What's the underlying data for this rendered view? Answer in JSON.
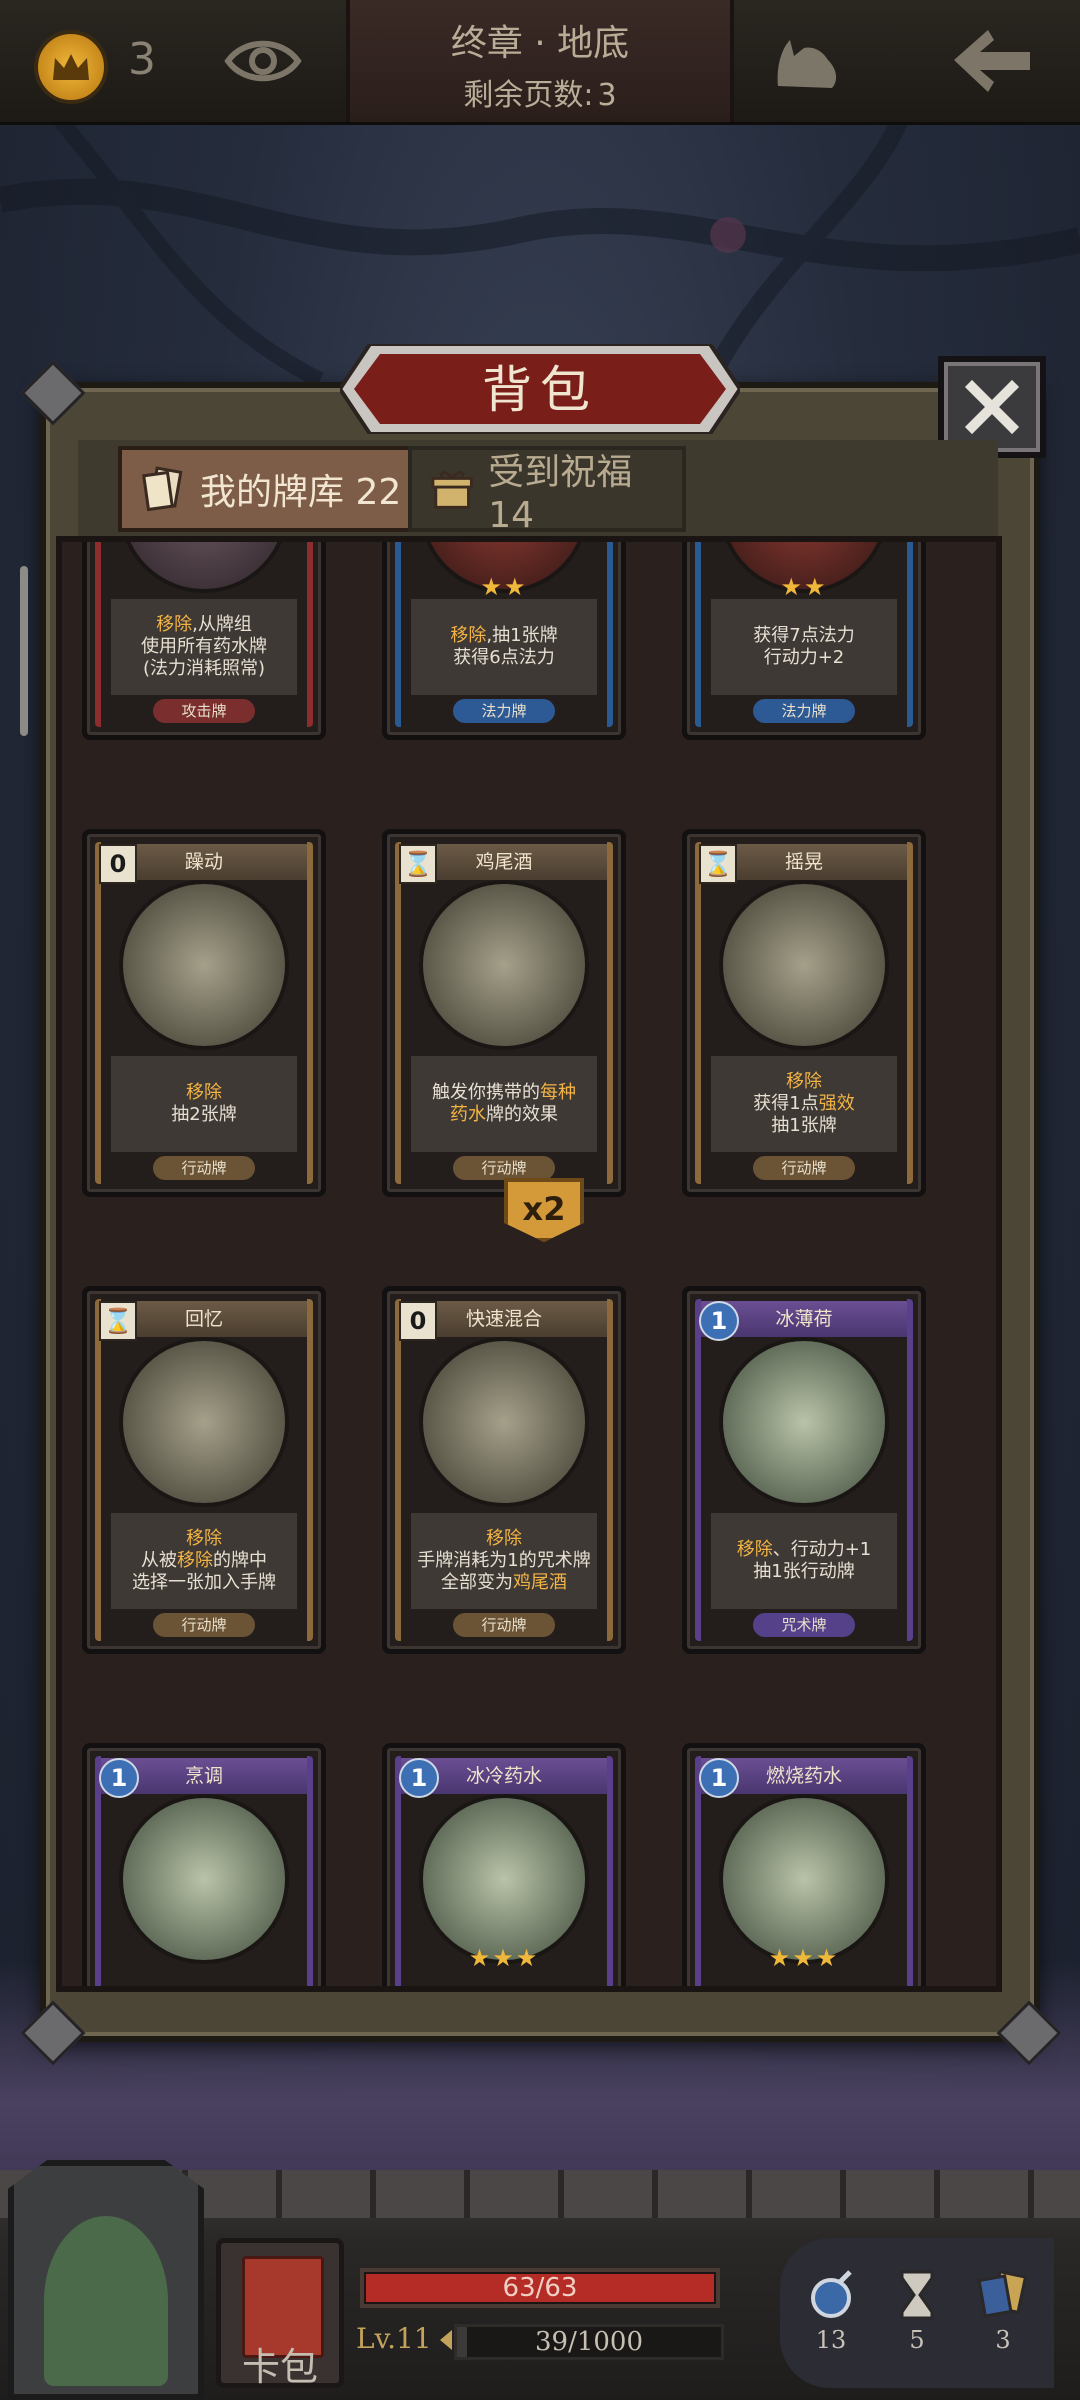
{
  "top_bar": {
    "crown_count": "3",
    "chapter": "终章 · 地底",
    "pages_label": "剩余页数:",
    "pages_value": "3"
  },
  "panel": {
    "title": "背包",
    "tabs": [
      {
        "label": "我的牌库 22",
        "active": true
      },
      {
        "label": "受到祝福 14",
        "active": false
      }
    ]
  },
  "cards": [
    {
      "name": "",
      "cost": "",
      "lines": [
        "移除,从牌组",
        "使用所有药水牌",
        "(法力消耗照常)"
      ],
      "highlight_words": [
        "移除"
      ],
      "type": "攻击牌",
      "class": "attack",
      "stars": 0
    },
    {
      "name": "",
      "cost": "",
      "lines": [
        "移除,抽1张牌",
        "获得6点法力"
      ],
      "highlight_words": [
        "移除"
      ],
      "type": "法力牌",
      "class": "magic",
      "stars": 2
    },
    {
      "name": "",
      "cost": "",
      "lines": [
        "获得7点法力",
        "行动力+2"
      ],
      "highlight_words": [],
      "type": "法力牌",
      "class": "magic",
      "stars": 2
    },
    {
      "name": "躁动",
      "cost": "0",
      "lines": [
        "移除",
        "抽2张牌"
      ],
      "highlight_words": [
        "移除"
      ],
      "type": "行动牌",
      "class": "action",
      "stars": 0
    },
    {
      "name": "鸡尾酒",
      "cost": "⌛",
      "lines": [
        "触发你携带的每种",
        "药水牌的效果"
      ],
      "highlight_words": [
        "每种",
        "药水"
      ],
      "type": "行动牌",
      "class": "action",
      "stars": 0
    },
    {
      "name": "摇晃",
      "cost": "⌛",
      "lines": [
        "移除",
        "获得1点强效",
        "抽1张牌"
      ],
      "highlight_words": [
        "移除",
        "强效"
      ],
      "type": "行动牌",
      "class": "action",
      "stars": 0
    },
    {
      "name": "回忆",
      "cost": "⌛",
      "lines": [
        "移除",
        "从被移除的牌中",
        "选择一张加入手牌"
      ],
      "highlight_words": [
        "移除"
      ],
      "type": "行动牌",
      "class": "action",
      "stars": 0
    },
    {
      "name": "快速混合",
      "cost": "0",
      "lines": [
        "移除",
        "手牌消耗为1的咒术牌",
        "全部变为鸡尾酒"
      ],
      "highlight_words": [
        "移除",
        "鸡尾酒"
      ],
      "type": "行动牌",
      "class": "action",
      "stars": 0
    },
    {
      "name": "冰薄荷",
      "cost": "1",
      "lines": [
        "移除、行动力+1",
        "抽1张行动牌"
      ],
      "highlight_words": [
        "移除"
      ],
      "type": "咒术牌",
      "class": "spell",
      "stars": 0
    },
    {
      "name": "烹调",
      "cost": "1",
      "lines": [],
      "highlight_words": [],
      "type": "",
      "class": "spell",
      "stars": 0
    },
    {
      "name": "冰冷药水",
      "cost": "1",
      "lines": [],
      "highlight_words": [],
      "type": "",
      "class": "spell",
      "stars": 3
    },
    {
      "name": "燃烧药水",
      "cost": "1",
      "lines": [],
      "highlight_words": [],
      "type": "",
      "class": "spell",
      "stars": 3
    }
  ],
  "multiplier_badge": "x2",
  "hud": {
    "card_pack_label": "卡包",
    "hp_text": "63/63",
    "hp_fraction": 1.0,
    "level": "Lv.11",
    "xp_text": "39/1000",
    "xp_fraction": 0.039,
    "resources": [
      {
        "icon": "orb-icon",
        "value": "13"
      },
      {
        "icon": "hourglass-icon",
        "value": "5"
      },
      {
        "icon": "cards-icon",
        "value": "3"
      }
    ]
  },
  "colors": {
    "highlight": "#f3b445",
    "hp": "#b52b25",
    "panel_bg": "#2a211f"
  }
}
